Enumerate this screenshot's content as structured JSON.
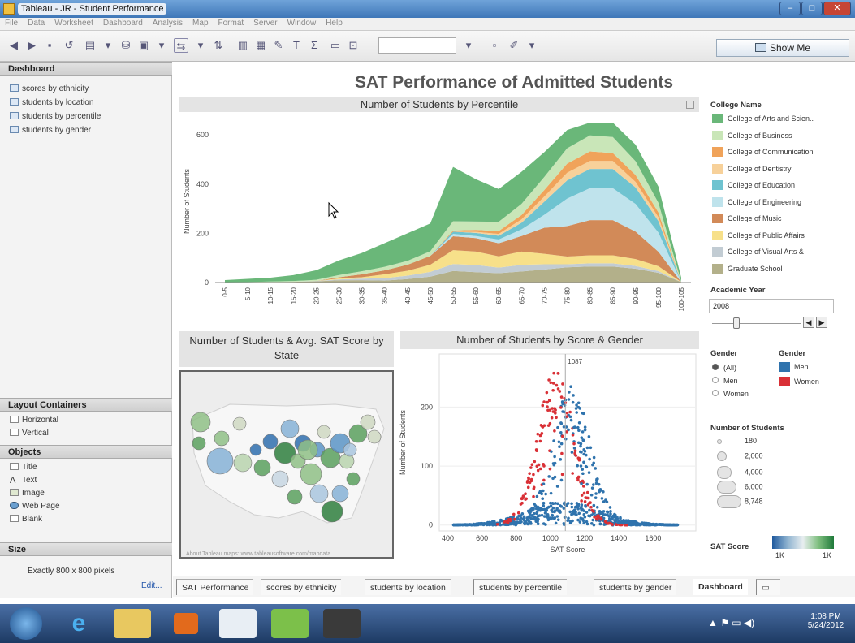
{
  "window": {
    "title": "Tableau - JR - Student Performance"
  },
  "menu": [
    "File",
    "Data",
    "Worksheet",
    "Dashboard",
    "Analysis",
    "Map",
    "Format",
    "Server",
    "Window",
    "Help"
  ],
  "toolbar": {
    "show_me": "Show Me"
  },
  "left_panel": {
    "dashboard_header": "Dashboard",
    "sheets": [
      "scores by ethnicity",
      "students by location",
      "students by percentile",
      "students by gender"
    ],
    "layout_header": "Layout Containers",
    "layout_items": [
      "Horizontal",
      "Vertical"
    ],
    "objects_header": "Objects",
    "objects": [
      "Title",
      "Text",
      "Image",
      "Web Page",
      "Blank"
    ],
    "size_header": "Size",
    "size_value": "Exactly 800 x 800 pixels",
    "edit_link": "Edit..."
  },
  "dashboard": {
    "title": "SAT Performance of Admitted Students",
    "percentile_sheet_title": "Number of Students by Percentile",
    "map_sheet_title": "Number of Students & Avg. SAT Score by State",
    "scatter_sheet_title": "Number of Students by Score & Gender",
    "map_attribution": "About Tableau maps: www.tableausoftware.com/mapdata"
  },
  "legend": {
    "college_header": "College Name",
    "colleges": [
      {
        "name": "College of Arts and Scien..",
        "color": "#6ab779"
      },
      {
        "name": "College of Business",
        "color": "#c9e6b8"
      },
      {
        "name": "College of Communication",
        "color": "#f0a35a"
      },
      {
        "name": "College of Dentistry",
        "color": "#f7d19a"
      },
      {
        "name": "College of Education",
        "color": "#6fc3d0"
      },
      {
        "name": "College of Engineering",
        "color": "#bfe3ec"
      },
      {
        "name": "College of Music",
        "color": "#d28a58"
      },
      {
        "name": "College of Public Affairs",
        "color": "#f7e08a"
      },
      {
        "name": "College of Visual Arts &",
        "color": "#c2ccd3"
      },
      {
        "name": "Graduate School",
        "color": "#b3b08a"
      }
    ],
    "year_header": "Academic Year",
    "year_value": "2008",
    "gender_filter_header": "Gender",
    "gender_options": [
      "(All)",
      "Men",
      "Women"
    ],
    "gender_color_header": "Gender",
    "gender_colors": [
      {
        "name": "Men",
        "color": "#2f73ad"
      },
      {
        "name": "Women",
        "color": "#d93036"
      }
    ],
    "size_header": "Number of Students",
    "size_values": [
      "180",
      "2,000",
      "4,000",
      "6,000",
      "8,748"
    ],
    "sat_header": "SAT Score",
    "sat_min": "1K",
    "sat_max": "1K"
  },
  "tabs": [
    "SAT Performance",
    "scores by ethnicity",
    "students by location",
    "students by percentile",
    "students by gender",
    "Dashboard"
  ],
  "taskbar": {
    "time": "1:08 PM",
    "date": "5/24/2012"
  },
  "chart_data": [
    {
      "type": "area",
      "title": "Number of Students by Percentile",
      "ylabel": "Number of Students",
      "xlabel": "",
      "ylim": [
        0,
        660
      ],
      "yticks": [
        0,
        200,
        400,
        600
      ],
      "categories": [
        "0-5",
        "5-10",
        "10-15",
        "15-20",
        "20-25",
        "25-30",
        "30-35",
        "35-40",
        "40-45",
        "45-50",
        "50-55",
        "55-60",
        "60-65",
        "65-70",
        "70-75",
        "75-80",
        "80-85",
        "85-90",
        "90-95",
        "95-100",
        "100-105"
      ],
      "stacked_top_approx": [
        10,
        15,
        20,
        30,
        50,
        90,
        120,
        160,
        200,
        240,
        470,
        420,
        380,
        450,
        530,
        620,
        650,
        650,
        560,
        390,
        20
      ]
    },
    {
      "type": "scatter",
      "title": "Number of Students by Score & Gender",
      "xlabel": "SAT Score",
      "ylabel": "Number of Students",
      "xlim": [
        350,
        1850
      ],
      "ylim": [
        -10,
        290
      ],
      "xticks": [
        400,
        600,
        800,
        1000,
        1200,
        1400,
        1600
      ],
      "yticks": [
        0,
        100,
        200
      ],
      "reference_line": {
        "x": 1087,
        "label": "1087"
      },
      "series": [
        {
          "name": "Men"
        },
        {
          "name": "Women"
        }
      ]
    }
  ]
}
